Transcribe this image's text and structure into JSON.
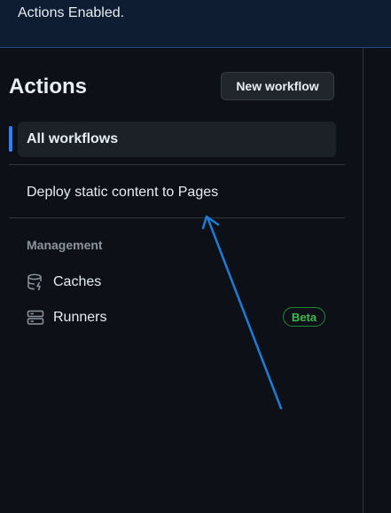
{
  "banner": {
    "text": "Actions Enabled."
  },
  "sidebar": {
    "title": "Actions",
    "new_workflow_label": "New workflow",
    "active_item": {
      "label": "All workflows"
    },
    "workflows": [
      {
        "label": "Deploy static content to Pages"
      }
    ],
    "management": {
      "heading": "Management",
      "items": [
        {
          "label": "Caches",
          "icon": "database-icon"
        },
        {
          "label": "Runners",
          "icon": "server-icon",
          "badge": "Beta"
        }
      ]
    }
  },
  "colors": {
    "background": "#0d1117",
    "accent": "#2f81f7",
    "badge_green": "#3fb950",
    "annotation_arrow": "#1f7bd6"
  }
}
